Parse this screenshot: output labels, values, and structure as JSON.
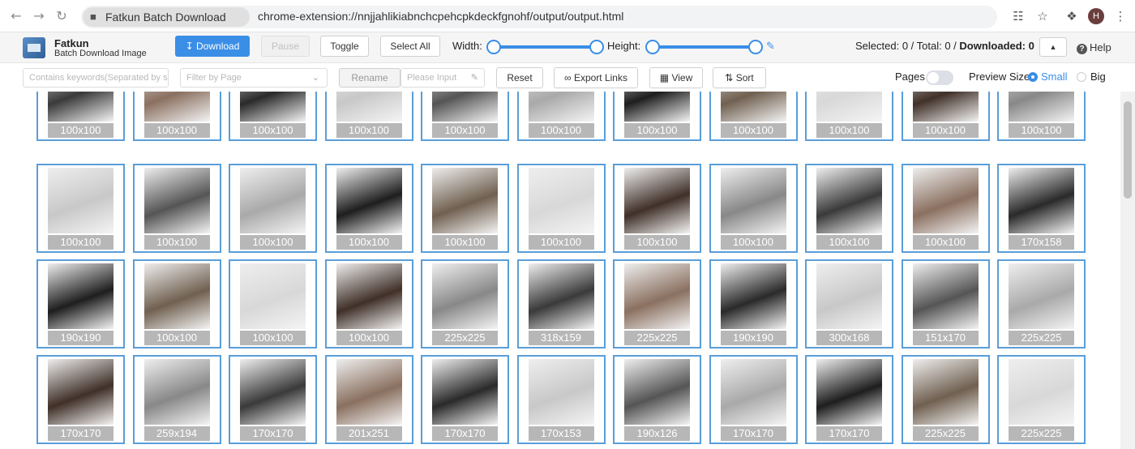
{
  "browser": {
    "tab_title": "Fatkun Batch Download Image",
    "url": "chrome-extension://nnjjahlikiabnchcpehcpkdeckfgnohf/output/output.html",
    "avatar_letter": "H",
    "icons": [
      "back-icon",
      "forward-icon",
      "reload-icon",
      "translate-icon",
      "star-icon",
      "extensions-icon",
      "menu-icon"
    ]
  },
  "app": {
    "name": "Fatkun",
    "subtitle": "Batch Download Image"
  },
  "toolbar": {
    "download": "Download",
    "pause": "Pause",
    "toggle": "Toggle",
    "select_all": "Select All",
    "width_label": "Width:",
    "height_label": "Height:",
    "stats_prefix": "Selected: 0 / Total: 0 / ",
    "downloaded": "Downloaded: 0",
    "help": "Help"
  },
  "filters": {
    "keywords_placeholder": "Contains keywords(Separated by space)",
    "page_placeholder": "Filter by Page",
    "rename": "Rename",
    "rename_placeholder": "Please Input",
    "reset": "Reset",
    "export_links": "Export Links",
    "view": "View",
    "sort": "Sort",
    "pages_label": "Pages",
    "preview_size_label": "Preview Size",
    "small": "Small",
    "big": "Big",
    "preview_selected": "Small",
    "pages_toggle_on": false
  },
  "accent_color": "#3a8ee6",
  "images": [
    [
      "100x100",
      "100x100",
      "100x100",
      "100x100",
      "100x100",
      "100x100",
      "100x100",
      "100x100",
      "100x100",
      "100x100",
      "100x100"
    ],
    [
      "100x100",
      "100x100",
      "100x100",
      "100x100",
      "100x100",
      "100x100",
      "100x100",
      "100x100",
      "100x100",
      "100x100",
      "170x158"
    ],
    [
      "190x190",
      "100x100",
      "100x100",
      "100x100",
      "225x225",
      "318x159",
      "225x225",
      "190x190",
      "300x168",
      "151x170",
      "225x225"
    ],
    [
      "170x170",
      "259x194",
      "170x170",
      "201x251",
      "170x170",
      "170x153",
      "190x126",
      "170x170",
      "170x170",
      "225x225",
      "225x225"
    ]
  ]
}
